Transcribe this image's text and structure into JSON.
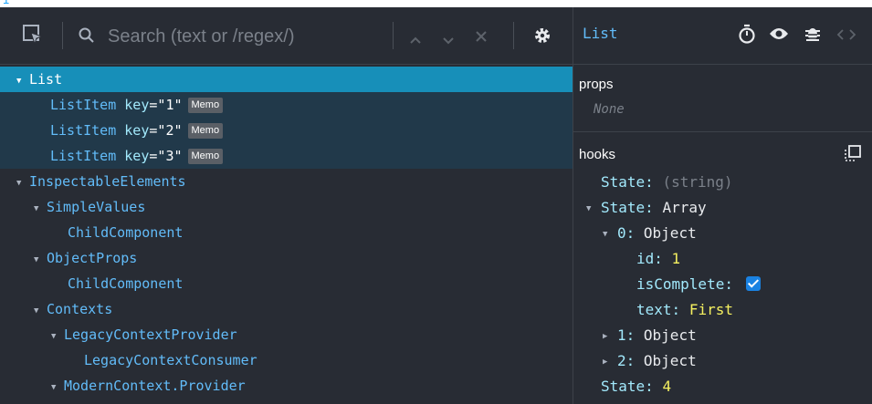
{
  "toolbar": {
    "search_placeholder": "Search (text or /regex/)",
    "icons": [
      "inspect-element-icon",
      "search-icon",
      "chevron-up-icon",
      "chevron-down-icon",
      "close-icon",
      "gear-icon"
    ]
  },
  "tree": {
    "rows": [
      {
        "name": "List",
        "depth": 0,
        "expanded": true,
        "selected": true
      },
      {
        "name": "ListItem",
        "depth": 1,
        "key": "1",
        "badge": "Memo"
      },
      {
        "name": "ListItem",
        "depth": 1,
        "key": "2",
        "badge": "Memo"
      },
      {
        "name": "ListItem",
        "depth": 1,
        "key": "3",
        "badge": "Memo"
      },
      {
        "name": "InspectableElements",
        "depth": 0,
        "expanded": true
      },
      {
        "name": "SimpleValues",
        "depth": 1,
        "expanded": true
      },
      {
        "name": "ChildComponent",
        "depth": 2
      },
      {
        "name": "ObjectProps",
        "depth": 1,
        "expanded": true
      },
      {
        "name": "ChildComponent",
        "depth": 2
      },
      {
        "name": "Contexts",
        "depth": 1,
        "expanded": true
      },
      {
        "name": "LegacyContextProvider",
        "depth": 2,
        "expanded": true
      },
      {
        "name": "LegacyContextConsumer",
        "depth": 3
      },
      {
        "name": "ModernContext.Provider",
        "depth": 2,
        "expanded": true
      }
    ],
    "key_attr": "key",
    "key_eq": "="
  },
  "inspector": {
    "title": "List",
    "header_icons": [
      "stopwatch-icon",
      "eye-icon",
      "bug-icon",
      "code-icon"
    ],
    "props_label": "props",
    "props_empty": "None",
    "hooks_label": "hooks",
    "hooks": {
      "state1_key": "State:",
      "state1_val": "(string)",
      "state2_key": "State:",
      "state2_val": "Array",
      "item0_key": "0:",
      "item0_val": "Object",
      "id_key": "id:",
      "id_val": "1",
      "complete_key": "isComplete:",
      "complete_val": true,
      "text_key": "text:",
      "text_val": "First",
      "item1_key": "1:",
      "item1_val": "Object",
      "item2_key": "2:",
      "item2_val": "Object",
      "state3_key": "State:",
      "state3_val": "4"
    }
  },
  "colors": {
    "background": "#282c34",
    "selected_row": "#178fb9",
    "child_row": "#21394a",
    "component_name": "#62bcf9",
    "value": "#f5f060"
  }
}
